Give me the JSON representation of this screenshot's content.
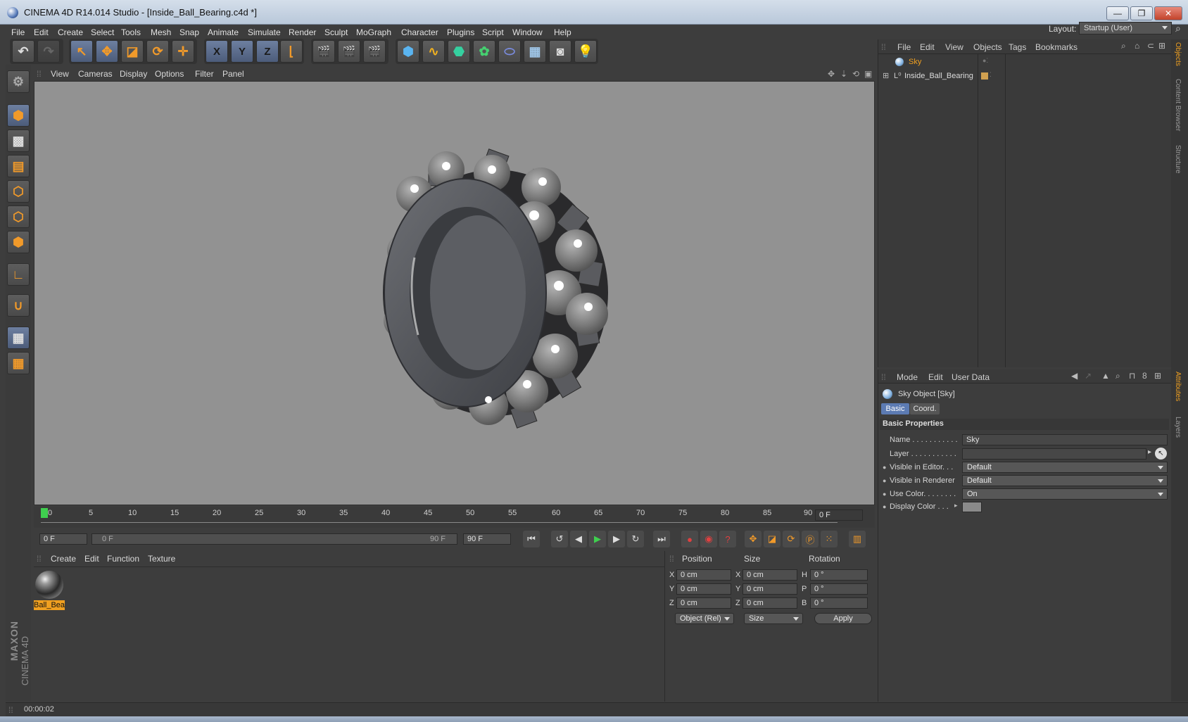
{
  "window": {
    "title": "CINEMA 4D R14.014 Studio - [Inside_Ball_Bearing.c4d *]",
    "minimize": "—",
    "restore": "❐",
    "close": "✕"
  },
  "menu": [
    "File",
    "Edit",
    "Create",
    "Select",
    "Tools",
    "Mesh",
    "Snap",
    "Animate",
    "Simulate",
    "Render",
    "Sculpt",
    "MoGraph",
    "Character",
    "Plugins",
    "Script",
    "Window",
    "Help"
  ],
  "layout": {
    "label": "Layout:",
    "value": "Startup (User)"
  },
  "toolbar": {
    "undo": "↶",
    "redo": "↷",
    "x_axis": "X",
    "y_axis": "Y",
    "z_axis": "Z"
  },
  "viewport": {
    "menu": [
      "View",
      "Cameras",
      "Display",
      "Options",
      "Filter",
      "Panel"
    ]
  },
  "timeline": {
    "ticks": [
      "0",
      "5",
      "10",
      "15",
      "20",
      "25",
      "30",
      "35",
      "40",
      "45",
      "50",
      "55",
      "60",
      "65",
      "70",
      "75",
      "80",
      "85",
      "90"
    ],
    "current_frame": "0 F",
    "start_field": "0 F",
    "range_start": "0 F",
    "range_end": "90 F",
    "end_field": "90 F"
  },
  "material_manager": {
    "menu": [
      "Create",
      "Edit",
      "Function",
      "Texture"
    ],
    "materials": [
      {
        "label": "Ball_Bea"
      }
    ]
  },
  "coordinates": {
    "headers": {
      "position": "Position",
      "size": "Size",
      "rotation": "Rotation"
    },
    "rows": [
      {
        "axis": "X",
        "pos": "0 cm",
        "size_axis": "X",
        "size": "0 cm",
        "rot_axis": "H",
        "rot": "0 °"
      },
      {
        "axis": "Y",
        "pos": "0 cm",
        "size_axis": "Y",
        "size": "0 cm",
        "rot_axis": "P",
        "rot": "0 °"
      },
      {
        "axis": "Z",
        "pos": "0 cm",
        "size_axis": "Z",
        "size": "0 cm",
        "rot_axis": "B",
        "rot": "0 °"
      }
    ],
    "mode_select": "Object (Rel)",
    "size_select": "Size",
    "apply": "Apply"
  },
  "status": {
    "time": "00:00:02"
  },
  "object_manager": {
    "menu": [
      "File",
      "Edit",
      "View",
      "Objects",
      "Tags",
      "Bookmarks"
    ],
    "objects": [
      {
        "name": "Sky",
        "selected": true
      },
      {
        "name": "Inside_Ball_Bearing",
        "selected": false
      }
    ]
  },
  "attributes": {
    "menu": [
      "Mode",
      "Edit",
      "User Data"
    ],
    "object_title": "Sky Object [Sky]",
    "tabs": [
      "Basic",
      "Coord."
    ],
    "section": "Basic Properties",
    "props": {
      "name_label": "Name . . . . . . . . . . .",
      "name_value": "Sky",
      "layer_label": "Layer . . . . . . . . . . .",
      "layer_value": "",
      "vis_editor_label": "Visible in Editor. . .",
      "vis_editor_value": "Default",
      "vis_render_label": "Visible in Renderer",
      "vis_render_value": "Default",
      "use_color_label": "Use Color. . . . . . . .",
      "use_color_value": "On",
      "display_color_label": "Display Color . . .",
      "display_color": "#8a8a8a"
    }
  },
  "right_tabs": [
    "Objects",
    "Content Browser",
    "Structure",
    "Attributes",
    "Layers"
  ],
  "branding": {
    "maxon": "MAXON",
    "product": "CINEMA 4D"
  },
  "colors": {
    "accent": "#f0a020",
    "selection_blue": "#5c7bb3"
  }
}
